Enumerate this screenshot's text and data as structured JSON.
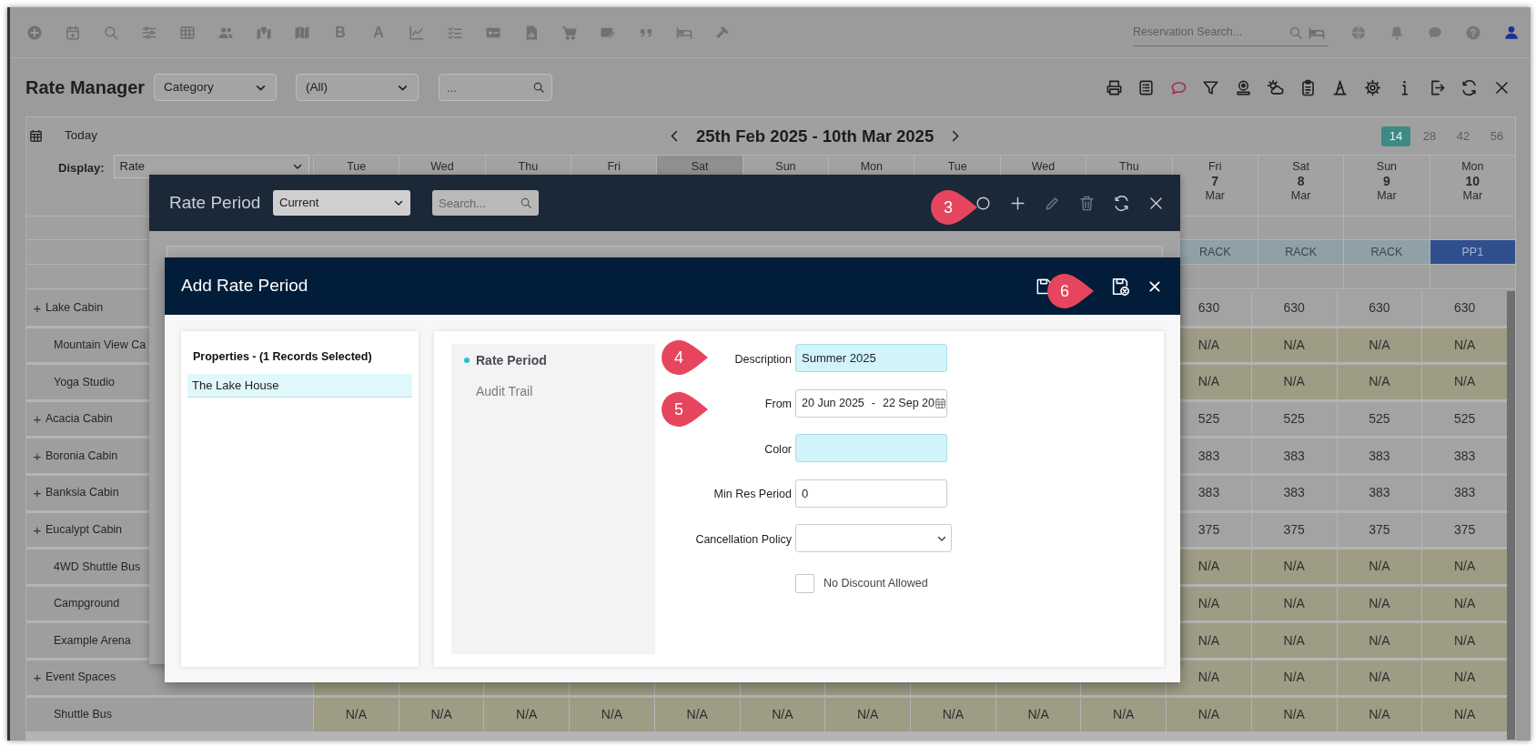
{
  "top_bar": {
    "items": [
      {
        "kind": "icon"
      },
      {
        "kind": "icon"
      },
      {
        "kind": "icon"
      },
      {
        "kind": "icon"
      },
      {
        "kind": "icon"
      },
      {
        "kind": "icon"
      },
      {
        "kind": "icon"
      },
      {
        "kind": "icon"
      },
      {
        "kind": "letter",
        "label": "B"
      },
      {
        "kind": "letter",
        "label": "A"
      },
      {
        "kind": "icon"
      },
      {
        "kind": "icon"
      },
      {
        "kind": "icon"
      },
      {
        "kind": "icon"
      },
      {
        "kind": "icon"
      },
      {
        "kind": "icon"
      },
      {
        "kind": "icon"
      },
      {
        "kind": "icon"
      },
      {
        "kind": "icon"
      }
    ],
    "search_placeholder": "Reservation Search..."
  },
  "page": {
    "title": "Rate Manager",
    "filters": [
      {
        "kind": "select",
        "value": "Category"
      },
      {
        "kind": "select",
        "value": "(All)"
      },
      {
        "kind": "search",
        "placeholder": "..."
      }
    ]
  },
  "calendar": {
    "today_label": "Today",
    "range": "25th Feb 2025 - 10th Mar 2025",
    "span_options": [
      {
        "label": "14",
        "selected": true
      },
      {
        "label": "28",
        "selected": false
      },
      {
        "label": "42",
        "selected": false
      },
      {
        "label": "56",
        "selected": false
      }
    ],
    "display_label": "Display:",
    "display_value": "Rate",
    "days": [
      {
        "weekday": "Tue",
        "highlighted": false
      },
      {
        "weekday": "Wed",
        "highlighted": false
      },
      {
        "weekday": "Thu",
        "highlighted": false
      },
      {
        "weekday": "Fri",
        "highlighted": false
      },
      {
        "weekday": "Sat",
        "highlighted": true
      },
      {
        "weekday": "Sun",
        "highlighted": false
      },
      {
        "weekday": "Mon",
        "highlighted": false
      },
      {
        "weekday": "Tue",
        "highlighted": false
      },
      {
        "weekday": "Wed",
        "highlighted": false
      },
      {
        "weekday": "Thu",
        "highlighted": false
      },
      {
        "weekday": "Fri",
        "day": "7",
        "month": "Mar",
        "code": {
          "label": "RACK",
          "color": "#8fa0a7"
        },
        "highlighted": false
      },
      {
        "weekday": "Sat",
        "day": "8",
        "month": "Mar",
        "code": {
          "label": "RACK",
          "color": "#8fa0a7"
        },
        "highlighted": false
      },
      {
        "weekday": "Sun",
        "day": "9",
        "month": "Mar",
        "code": {
          "label": "RACK",
          "color": "#8fa0a7"
        },
        "highlighted": false
      },
      {
        "weekday": "Mon",
        "day": "10",
        "month": "Mar",
        "code": {
          "label": "PP1",
          "color": "#2f4f8e"
        },
        "highlighted": false
      }
    ],
    "rows": [
      {
        "toggle": "+",
        "name": "Lake Cabin",
        "closed": false,
        "values": [
          "630",
          "630",
          "630",
          "630"
        ]
      },
      {
        "name": "Mountain View Ca",
        "closed": true,
        "values": [
          "N/A",
          "N/A",
          "N/A",
          "N/A"
        ]
      },
      {
        "name": "Yoga Studio",
        "closed": true,
        "values": [
          "N/A",
          "N/A",
          "N/A",
          "N/A"
        ]
      },
      {
        "toggle": "+",
        "name": "Acacia Cabin",
        "closed": false,
        "values": [
          "525",
          "525",
          "525",
          "525"
        ]
      },
      {
        "toggle": "+",
        "name": "Boronia Cabin",
        "closed": false,
        "values": [
          "383",
          "383",
          "383",
          "383"
        ]
      },
      {
        "toggle": "+",
        "name": "Banksia Cabin",
        "closed": false,
        "values": [
          "383",
          "383",
          "383",
          "383"
        ]
      },
      {
        "toggle": "+",
        "name": "Eucalypt Cabin",
        "closed": false,
        "values": [
          "375",
          "375",
          "375",
          "375"
        ]
      },
      {
        "name": "4WD Shuttle Bus",
        "closed": true,
        "values": [
          "N/A",
          "N/A",
          "N/A",
          "N/A"
        ]
      },
      {
        "name": "Campground",
        "closed": true,
        "values": [
          "N/A",
          "N/A",
          "N/A",
          "N/A"
        ]
      },
      {
        "name": "Example Arena",
        "closed": true,
        "values": [
          "N/A",
          "N/A",
          "N/A",
          "N/A"
        ]
      },
      {
        "toggle": "+",
        "name": "Event Spaces",
        "closed": true,
        "values": [
          "N/A",
          "N/A",
          "N/A",
          "N/A"
        ]
      },
      {
        "name": "Shuttle Bus",
        "closed": true,
        "values": [
          "N/A",
          "N/A",
          "N/A",
          "N/A",
          "N/A",
          "N/A",
          "N/A",
          "N/A",
          "N/A",
          "N/A",
          "N/A",
          "N/A",
          "N/A",
          "N/A"
        ]
      }
    ]
  },
  "rate_period_dialog": {
    "title": "Rate Period",
    "filter_value": "Current",
    "search_placeholder": "Search...",
    "callout": "3"
  },
  "add_rate_period_dialog": {
    "title": "Add Rate Period",
    "callout": "6",
    "properties": {
      "heading": "Properties - (1 Records Selected)",
      "items": [
        {
          "label": "The Lake House",
          "selected": true
        }
      ]
    },
    "tabs": [
      {
        "label": "Rate Period",
        "selected": true
      },
      {
        "label": "Audit Trail",
        "selected": false
      }
    ],
    "fields": [
      {
        "kind": "text",
        "label": "Description",
        "value": "Summer 2025",
        "highlighted": true,
        "callout": "4"
      },
      {
        "kind": "date_range",
        "label": "From",
        "value": "20 Jun 2025",
        "separator": "-",
        "value_end": "22 Sep 20",
        "callout": "5"
      },
      {
        "kind": "text",
        "label": "Color",
        "highlighted": true
      },
      {
        "kind": "text",
        "label": "Min Res Period",
        "value": "0",
        "highlighted": false
      },
      {
        "kind": "select",
        "label": "Cancellation Policy"
      },
      {
        "kind": "checkbox",
        "label": "No Discount Allowed",
        "checked": false
      }
    ]
  }
}
